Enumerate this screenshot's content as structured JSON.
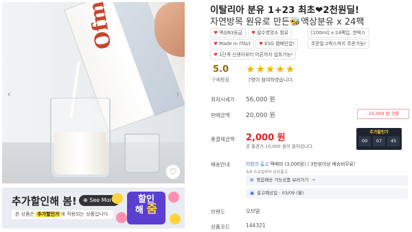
{
  "product": {
    "title": "이탈리아 분유 1+23 최초❤2천원딜!",
    "subtitle": "자연방목 원유로 만든🐝액상분유 x 24팩",
    "tags": [
      {
        "icon": "♥",
        "label": "액상83등급"
      },
      {
        "icon": "♥",
        "label": "필수영양소 함유"
      },
      {
        "icon": "",
        "label": "[100ml] x 24팩입, 한박스"
      },
      {
        "icon": "♥",
        "label": "Made in ITALY"
      },
      {
        "icon": "♥",
        "label": "ESG 캠페인업!"
      },
      {
        "icon": "",
        "label": "주문일 2박스까지 주문가능!"
      },
      {
        "icon": "♥",
        "label": "1단계 신생아부터 어른까지 섭취가능!"
      }
    ],
    "carton_logo": "Ofmom",
    "wish_icon": "heart-outline-icon"
  },
  "rating": {
    "score": "5.0",
    "label": "구매평점",
    "stars": "★★★★★",
    "count_text": "7명이 참여하였습니다."
  },
  "prices": {
    "lowest_label": "최저시세가",
    "lowest_value": "56,000 원",
    "sale_label": "판매금액",
    "sale_value": "20,000 원",
    "coupon_button": "-10,000 원 쿠폰",
    "final_label": "총결제금액",
    "final_value": "2,000 원",
    "final_note": "공 총견가 10,000 원이 들아갔니다.",
    "timer_title": "추가할인가",
    "timer": [
      "00",
      "07",
      "45"
    ]
  },
  "shipping": {
    "label": "배송안내",
    "line1_blue": "리빙크 출고",
    "line1_rest": " 택배비 (3,000원) / 3만원이상 배송비무료!",
    "line2": "3/4 수요일부터 순차출고",
    "bundle_link": "묶음배송 가능상품 보러가기",
    "release_date": "출고예상일 : 03/09 (월)"
  },
  "details": {
    "brand_label": "브랜드",
    "brand_value": "오브맘",
    "code_label": "상품코드",
    "code_value": "144321"
  },
  "banner": {
    "title": "추가할인해 봄!",
    "see_more": "See More",
    "sub_pre": "본 상품은 ",
    "sub_highlight": "추가할인가",
    "sub_post": "에 적용되는 상품입니다.",
    "badge_line1": "할인",
    "badge_line2": "해",
    "badge_big": "줌"
  },
  "colors": {
    "accent_red": "#e02020",
    "star": "#f5b400",
    "link_blue": "#2c6bd6",
    "banner_bg": "#e9ecf3",
    "badge_purple": "#5a3fd1"
  }
}
